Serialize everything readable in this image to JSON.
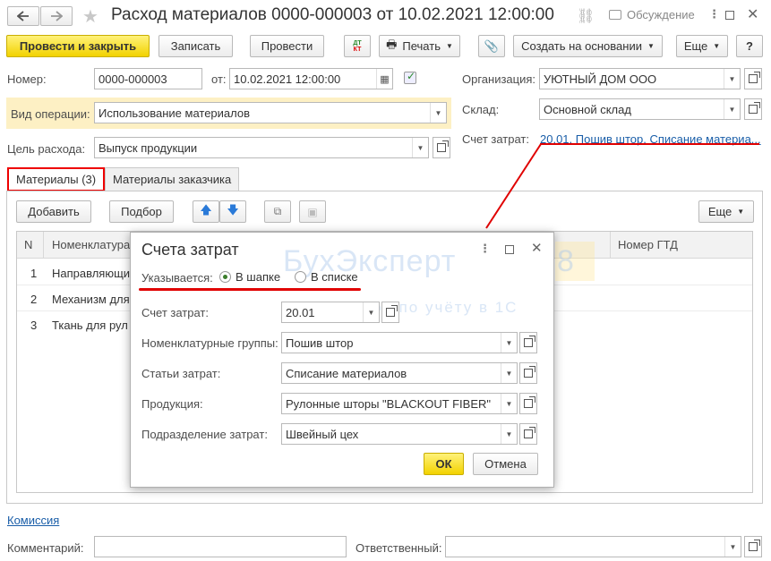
{
  "title": "Расход материалов 0000-000003 от 10.02.2021 12:00:00",
  "discussion_label": "Обсуждение",
  "toolbar": {
    "post_close": "Провести и закрыть",
    "write": "Записать",
    "post": "Провести",
    "dtkt": "Дт\nКт",
    "print": "Печать",
    "create_based": "Создать на основании",
    "more": "Еще",
    "help": "?"
  },
  "form": {
    "number_label": "Номер:",
    "number_value": "0000-000003",
    "date_label": "от:",
    "date_value": "10.02.2021 12:00:00",
    "org_label": "Организация:",
    "org_value": "УЮТНЫЙ ДОМ ООО",
    "op_label": "Вид операции:",
    "op_value": "Использование материалов",
    "warehouse_label": "Склад:",
    "warehouse_value": "Основной склад",
    "purpose_label": "Цель расхода:",
    "purpose_value": "Выпуск продукции",
    "cost_account_label": "Счет затрат:",
    "cost_account_link": "20.01, Пошив штор, Списание материа..."
  },
  "tabs": [
    "Материалы (3)",
    "Материалы заказчика"
  ],
  "table_toolbar": {
    "add": "Добавить",
    "select": "Подбор",
    "more": "Еще"
  },
  "table": {
    "headers": [
      "N",
      "Номенклатура",
      "Номер ГТД"
    ],
    "rows": [
      {
        "n": "1",
        "name": "Направляющи"
      },
      {
        "n": "2",
        "name": "Механизм для"
      },
      {
        "n": "3",
        "name": "Ткань для рул"
      }
    ]
  },
  "footer": {
    "commission": "Комиссия",
    "comment_label": "Комментарий:",
    "responsible_label": "Ответственный:"
  },
  "dialog": {
    "title": "Счета затрат",
    "specified_label": "Указывается:",
    "radio_header": "В шапке",
    "radio_list": "В списке",
    "account_label": "Счет затрат:",
    "account_value": "20.01",
    "nomgroup_label": "Номенклатурные группы:",
    "nomgroup_value": "Пошив штор",
    "costitem_label": "Статьи затрат:",
    "costitem_value": "Списание материалов",
    "product_label": "Продукция:",
    "product_value": "Рулонные шторы \"BLACKOUT FIBER\"",
    "dept_label": "Подразделение затрат:",
    "dept_value": "Швейный цех",
    "ok": "ОК",
    "cancel": "Отмена"
  },
  "watermark": {
    "brand": "БухЭксперт",
    "digit": "8",
    "tagline": "а ответов по учёту в 1С"
  },
  "colors": {
    "accent_yellow": "#f2d200",
    "highlight_red": "#e00000",
    "link_blue": "#1a5ea8",
    "op_field_bg": "#fdf0c4"
  }
}
